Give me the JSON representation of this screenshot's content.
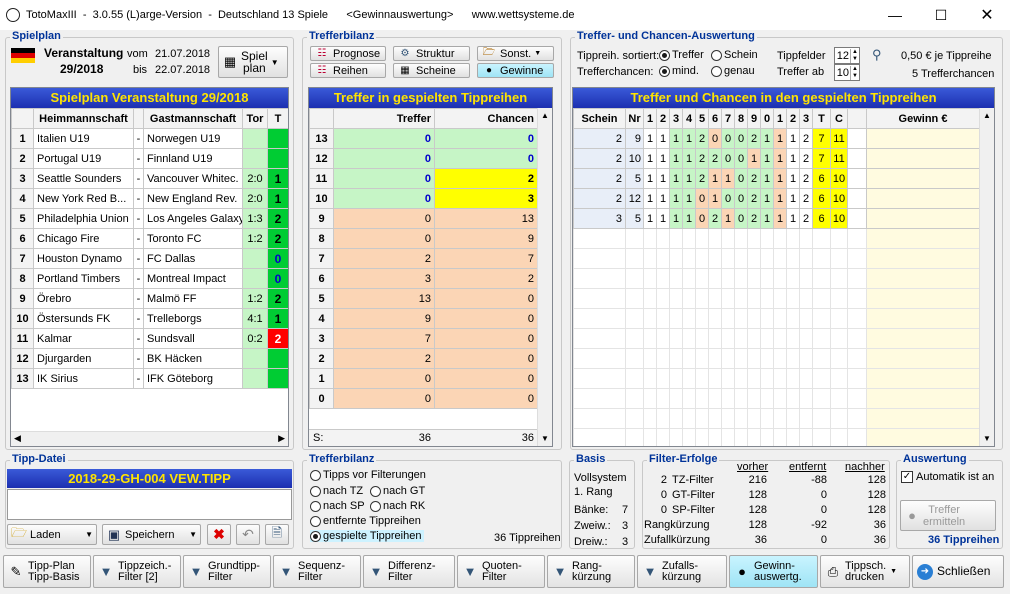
{
  "window": {
    "title": "TotoMaxIII  -  3.0.55 (L)arge-Version  -  Deutschland 13 Spiele      <Gewinnauswertung>      www.wettsysteme.de"
  },
  "spielplan": {
    "label": "Spielplan",
    "veranstaltung_label": "Veranstaltung",
    "veranstaltung": "29/2018",
    "vom_label": "vom",
    "vom": "21.07.2018",
    "bis_label": "bis",
    "bis": "22.07.2018",
    "button_line1": "Spiel",
    "button_line2": "plan",
    "grid_title": "Spielplan Veranstaltung 29/2018",
    "headers": [
      "Heimmannschaft",
      "Gastmannschaft",
      "Tor",
      "T"
    ],
    "rows": [
      {
        "n": "1",
        "home": "Italien U19",
        "away": "Norwegen U19",
        "tor": "",
        "t": ""
      },
      {
        "n": "2",
        "home": "Portugal U19",
        "away": "Finnland U19",
        "tor": "",
        "t": ""
      },
      {
        "n": "3",
        "home": "Seattle Sounders",
        "away": "Vancouver Whitec.",
        "tor": "2:0",
        "t": "1"
      },
      {
        "n": "4",
        "home": "New York Red B...",
        "away": "New England Rev.",
        "tor": "2:0",
        "t": "1"
      },
      {
        "n": "5",
        "home": "Philadelphia Union",
        "away": "Los Angeles Galaxy",
        "tor": "1:3",
        "t": "2"
      },
      {
        "n": "6",
        "home": "Chicago Fire",
        "away": "Toronto FC",
        "tor": "1:2",
        "t": "2"
      },
      {
        "n": "7",
        "home": "Houston Dynamo",
        "away": "FC Dallas",
        "tor": "",
        "t": "0"
      },
      {
        "n": "8",
        "home": "Portland Timbers",
        "away": "Montreal Impact",
        "tor": "",
        "t": "0"
      },
      {
        "n": "9",
        "home": "Örebro",
        "away": "Malmö FF",
        "tor": "1:2",
        "t": "2"
      },
      {
        "n": "10",
        "home": "Östersunds FK",
        "away": "Trelleborgs",
        "tor": "4:1",
        "t": "1"
      },
      {
        "n": "11",
        "home": "Kalmar",
        "away": "Sundsvall",
        "tor": "0:2",
        "t": "2"
      },
      {
        "n": "12",
        "home": "Djurgarden",
        "away": "BK Häcken",
        "tor": "",
        "t": ""
      },
      {
        "n": "13",
        "home": "IK Sirius",
        "away": "IFK Göteborg",
        "tor": "",
        "t": ""
      }
    ]
  },
  "trefferbilanz": {
    "label": "Trefferbilanz",
    "buttons": [
      "Prognose",
      "Reihen",
      "Struktur",
      "Scheine",
      "Sonst.",
      "Gewinne"
    ],
    "grid_title": "Treffer in gespielten Tippreihen",
    "headers": [
      "Treffer",
      "Chancen"
    ],
    "rows": [
      {
        "n": "13",
        "treffer": "0",
        "chancen": "0"
      },
      {
        "n": "12",
        "treffer": "0",
        "chancen": "0"
      },
      {
        "n": "11",
        "treffer": "0",
        "chancen": "2"
      },
      {
        "n": "10",
        "treffer": "0",
        "chancen": "3"
      },
      {
        "n": "9",
        "treffer": "0",
        "chancen": "13"
      },
      {
        "n": "8",
        "treffer": "0",
        "chancen": "9"
      },
      {
        "n": "7",
        "treffer": "2",
        "chancen": "7"
      },
      {
        "n": "6",
        "treffer": "3",
        "chancen": "2"
      },
      {
        "n": "5",
        "treffer": "13",
        "chancen": "0"
      },
      {
        "n": "4",
        "treffer": "9",
        "chancen": "0"
      },
      {
        "n": "3",
        "treffer": "7",
        "chancen": "0"
      },
      {
        "n": "2",
        "treffer": "2",
        "chancen": "0"
      },
      {
        "n": "1",
        "treffer": "0",
        "chancen": "0"
      },
      {
        "n": "0",
        "treffer": "0",
        "chancen": "0"
      }
    ],
    "sum_label": "S:",
    "sum_treffer": "36",
    "sum_chancen": "36"
  },
  "auswertung_top": {
    "label": "Treffer- und Chancen-Auswertung",
    "sort_label": "Tippreih. sortiert:",
    "sort_opt1": "Treffer",
    "sort_opt2": "Schein",
    "chancen_label": "Trefferchancen:",
    "ch_opt1": "mind.",
    "ch_opt2": "genau",
    "tippfelder_label": "Tippfelder",
    "tippfelder": "12",
    "treffer_ab_label": "Treffer ab",
    "treffer_ab": "10",
    "price": "0,50 € je Tippreihe",
    "chancen_count": "5 Trefferchancen",
    "grid_title": "Treffer und Chancen in den gespielten Tippreihen",
    "headers": [
      "Schein",
      "Nr",
      "1",
      "2",
      "3",
      "4",
      "5",
      "6",
      "7",
      "8",
      "9",
      "0",
      "1",
      "2",
      "3",
      "T",
      "C",
      "Gewinn €"
    ],
    "rows": [
      {
        "schein": "2",
        "nr": "9",
        "tips": [
          "1",
          "1",
          "1",
          "1",
          "2",
          "0",
          "0",
          "0",
          "2",
          "1",
          "1",
          "1",
          "2"
        ],
        "t": "7",
        "c": "11"
      },
      {
        "schein": "2",
        "nr": "10",
        "tips": [
          "1",
          "1",
          "1",
          "1",
          "2",
          "2",
          "0",
          "0",
          "1",
          "1",
          "1",
          "1",
          "2"
        ],
        "t": "7",
        "c": "11"
      },
      {
        "schein": "2",
        "nr": "5",
        "tips": [
          "1",
          "1",
          "1",
          "1",
          "2",
          "1",
          "1",
          "0",
          "2",
          "1",
          "1",
          "1",
          "2"
        ],
        "t": "6",
        "c": "10"
      },
      {
        "schein": "2",
        "nr": "12",
        "tips": [
          "1",
          "1",
          "1",
          "1",
          "0",
          "1",
          "0",
          "0",
          "2",
          "1",
          "1",
          "1",
          "2"
        ],
        "t": "6",
        "c": "10"
      },
      {
        "schein": "3",
        "nr": "5",
        "tips": [
          "1",
          "1",
          "1",
          "1",
          "0",
          "2",
          "1",
          "0",
          "2",
          "1",
          "1",
          "1",
          "2"
        ],
        "t": "6",
        "c": "10"
      }
    ]
  },
  "tipp_datei": {
    "label": "Tipp-Datei",
    "filename": "2018-29-GH-004 VEW.TIPP",
    "laden": "Laden",
    "speichern": "Speichern"
  },
  "filter_bilanz": {
    "label": "Trefferbilanz",
    "opts": [
      "Tipps vor Filterungen",
      "nach TZ",
      "nach GT",
      "nach SP",
      "nach RK",
      "entfernte Tippreihen",
      "gespielte Tippreihen"
    ],
    "count": "36 Tippreihen"
  },
  "basis": {
    "label": "Basis",
    "line1": "Vollsystem",
    "line2": "1. Rang",
    "baenke_label": "Bänke:",
    "baenke": "7",
    "zweiw_label": "Zweiw.:",
    "zweiw": "3",
    "dreiw_label": "Dreiw.:",
    "dreiw": "3"
  },
  "filter_erfolge": {
    "label": "Filter-Erfolge",
    "col_vorher": "vorher",
    "col_entfernt": "entfernt",
    "col_nachher": "nachher",
    "rows": [
      {
        "pre": "2",
        "name": "TZ-Filter",
        "vorher": "216",
        "entfernt": "-88",
        "nachher": "128"
      },
      {
        "pre": "0",
        "name": "GT-Filter",
        "vorher": "128",
        "entfernt": "0",
        "nachher": "128"
      },
      {
        "pre": "0",
        "name": "SP-Filter",
        "vorher": "128",
        "entfernt": "0",
        "nachher": "128"
      },
      {
        "pre": "",
        "name": "Rangkürzung",
        "vorher": "128",
        "entfernt": "-92",
        "nachher": "36"
      },
      {
        "pre": "",
        "name": "Zufallkürzung",
        "vorher": "36",
        "entfernt": "0",
        "nachher": "36"
      }
    ]
  },
  "auswertung": {
    "label": "Auswertung",
    "auto_label": "Automatik ist an",
    "btn_line1": "Treffer",
    "btn_line2": "ermitteln",
    "count": "36 Tippreihen"
  },
  "bottom": [
    {
      "l1": "Tipp-Plan",
      "l2": "Tipp-Basis"
    },
    {
      "l1": "Tippzeich.-",
      "l2": "Filter [2]"
    },
    {
      "l1": "Grundtipp-",
      "l2": "Filter"
    },
    {
      "l1": "Sequenz-",
      "l2": "Filter"
    },
    {
      "l1": "Differenz-",
      "l2": "Filter"
    },
    {
      "l1": "Quoten-",
      "l2": "Filter"
    },
    {
      "l1": "Rang-",
      "l2": "kürzung"
    },
    {
      "l1": "Zufalls-",
      "l2": "kürzung"
    },
    {
      "l1": "Gewinn-",
      "l2": "auswertg."
    },
    {
      "l1": "Tippsch.",
      "l2": "drucken"
    },
    {
      "l1": "Schließen",
      "l2": ""
    }
  ],
  "colors": {
    "accent": "#003399",
    "grid_title_bg": "#1c2fb0",
    "grid_title_fg": "#ffe400",
    "green_cell": "#c6f5c6",
    "orange_cell": "#fbd5b5",
    "yellow_cell": "#ffff00",
    "result_green": "#00cc33",
    "result_red": "#ff0000"
  }
}
